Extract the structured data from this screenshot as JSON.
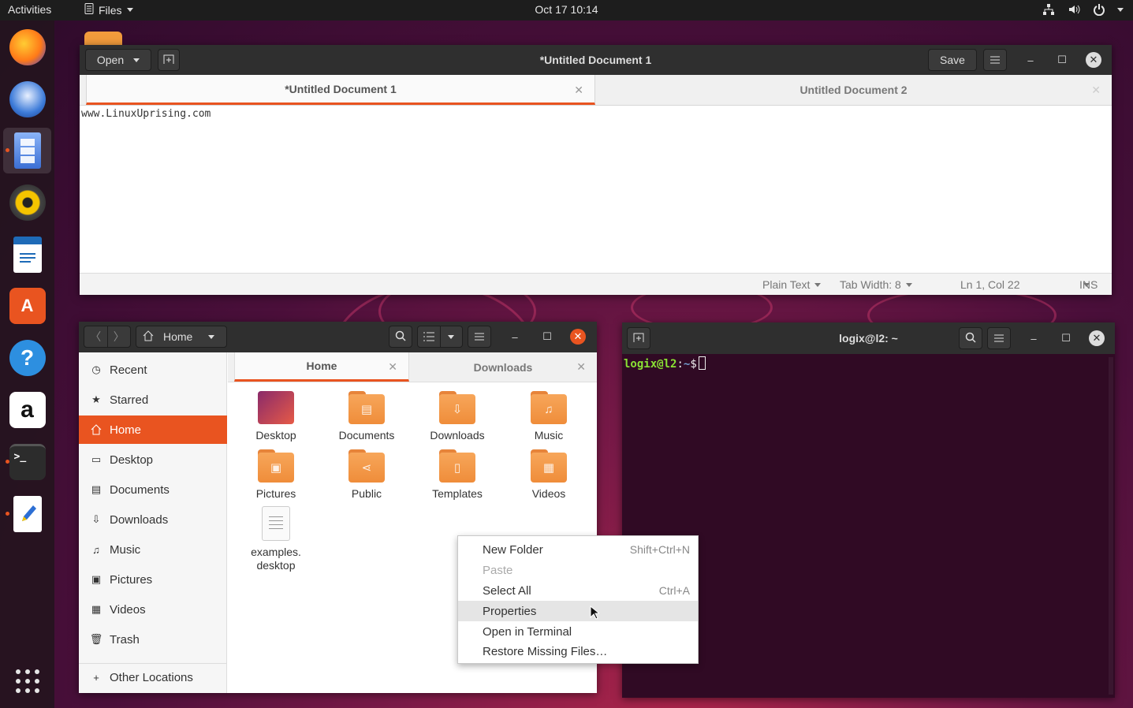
{
  "topbar": {
    "activities": "Activities",
    "app_menu": "Files",
    "clock": "Oct 17  10:14"
  },
  "dock": {
    "items": [
      "firefox-icon",
      "thunderbird-icon",
      "files-icon",
      "rhythmbox-icon",
      "writer-icon",
      "software-icon",
      "help-icon",
      "amazon-icon",
      "terminal-icon",
      "text-editor-icon"
    ],
    "amazon_letter": "a",
    "terminal_prompt": ">_"
  },
  "gedit": {
    "open_label": "Open",
    "title": "*Untitled Document 1",
    "save_label": "Save",
    "tabs": [
      {
        "label": "*Untitled Document 1"
      },
      {
        "label": "Untitled Document 2"
      }
    ],
    "content": "www.LinuxUprising.com",
    "status": {
      "language": "Plain Text",
      "tab_width": "Tab Width: 8",
      "position": "Ln 1, Col 22",
      "mode": "INS"
    }
  },
  "files": {
    "location": "Home",
    "sidebar": [
      {
        "label": "Recent",
        "icon": "clock-icon"
      },
      {
        "label": "Starred",
        "icon": "star-icon"
      },
      {
        "label": "Home",
        "icon": "home-icon"
      },
      {
        "label": "Desktop",
        "icon": "desktop-icon"
      },
      {
        "label": "Documents",
        "icon": "document-icon"
      },
      {
        "label": "Downloads",
        "icon": "download-icon"
      },
      {
        "label": "Music",
        "icon": "music-icon"
      },
      {
        "label": "Pictures",
        "icon": "picture-icon"
      },
      {
        "label": "Videos",
        "icon": "video-icon"
      },
      {
        "label": "Trash",
        "icon": "trash-icon"
      },
      {
        "label": "Other Locations",
        "icon": "plus-icon"
      }
    ],
    "tabs": [
      {
        "label": "Home"
      },
      {
        "label": "Downloads"
      }
    ],
    "items": [
      {
        "label": "Desktop"
      },
      {
        "label": "Documents"
      },
      {
        "label": "Downloads"
      },
      {
        "label": "Music"
      },
      {
        "label": "Pictures"
      },
      {
        "label": "Public"
      },
      {
        "label": "Templates"
      },
      {
        "label": "Videos"
      },
      {
        "label": "examples.",
        "label2": "desktop"
      }
    ]
  },
  "context_menu": [
    {
      "label": "New Folder",
      "accel": "Shift+Ctrl+N"
    },
    {
      "label": "Paste",
      "accel": ""
    },
    {
      "label": "Select All",
      "accel": "Ctrl+A"
    },
    {
      "label": "Properties",
      "accel": ""
    },
    {
      "label": "Open in Terminal",
      "accel": ""
    },
    {
      "label": "Restore Missing Files…",
      "accel": ""
    }
  ],
  "terminal": {
    "title": "logix@l2: ~",
    "prompt_user": "logix@l2",
    "prompt_sep": ":",
    "prompt_path": "~",
    "prompt_symbol": "$"
  },
  "colors": {
    "accent": "#e95420",
    "terminal_bg": "#300a24",
    "headerbar": "#2f2f2f"
  }
}
